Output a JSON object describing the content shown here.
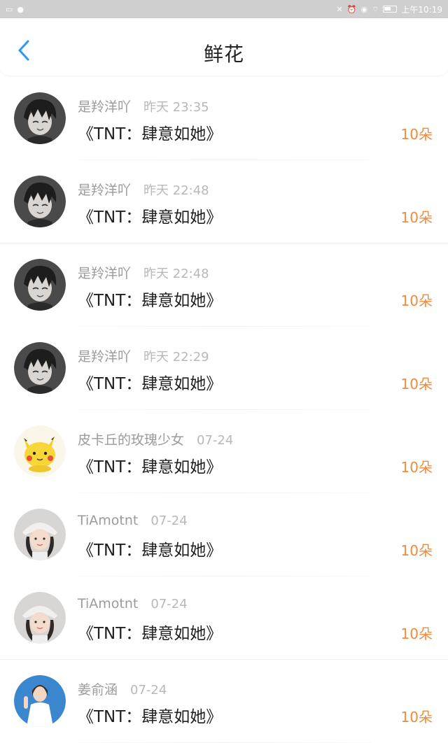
{
  "status_bar": {
    "time": "上午10:19"
  },
  "header": {
    "title": "鲜花"
  },
  "list": [
    {
      "name": "是羚洋吖",
      "time": "昨天 23:35",
      "book": "《TNT：肆意如她》",
      "count": "10朵",
      "avatar": "boy"
    },
    {
      "name": "是羚洋吖",
      "time": "昨天 22:48",
      "book": "《TNT：肆意如她》",
      "count": "10朵",
      "avatar": "boy"
    },
    {
      "name": "是羚洋吖",
      "time": "昨天 22:48",
      "book": "《TNT：肆意如她》",
      "count": "10朵",
      "avatar": "boy"
    },
    {
      "name": "是羚洋吖",
      "time": "昨天 22:29",
      "book": "《TNT：肆意如她》",
      "count": "10朵",
      "avatar": "boy"
    },
    {
      "name": "皮卡丘的玫瑰少女",
      "time": "07-24",
      "book": "《TNT：肆意如她》",
      "count": "10朵",
      "avatar": "pikachu"
    },
    {
      "name": "TiAmotnt",
      "time": "07-24",
      "book": "《TNT：肆意如她》",
      "count": "10朵",
      "avatar": "girl-hat"
    },
    {
      "name": "TiAmotnt",
      "time": "07-24",
      "book": "《TNT：肆意如她》",
      "count": "10朵",
      "avatar": "girl-hat"
    },
    {
      "name": "姜俞涵",
      "time": "07-24",
      "book": "《TNT：肆意如她》",
      "count": "10朵",
      "avatar": "girl-dress"
    }
  ],
  "colors": {
    "accent_blue": "#2b9af3",
    "count_orange": "#f08a3c",
    "status_bar": "#cfcfcf"
  }
}
